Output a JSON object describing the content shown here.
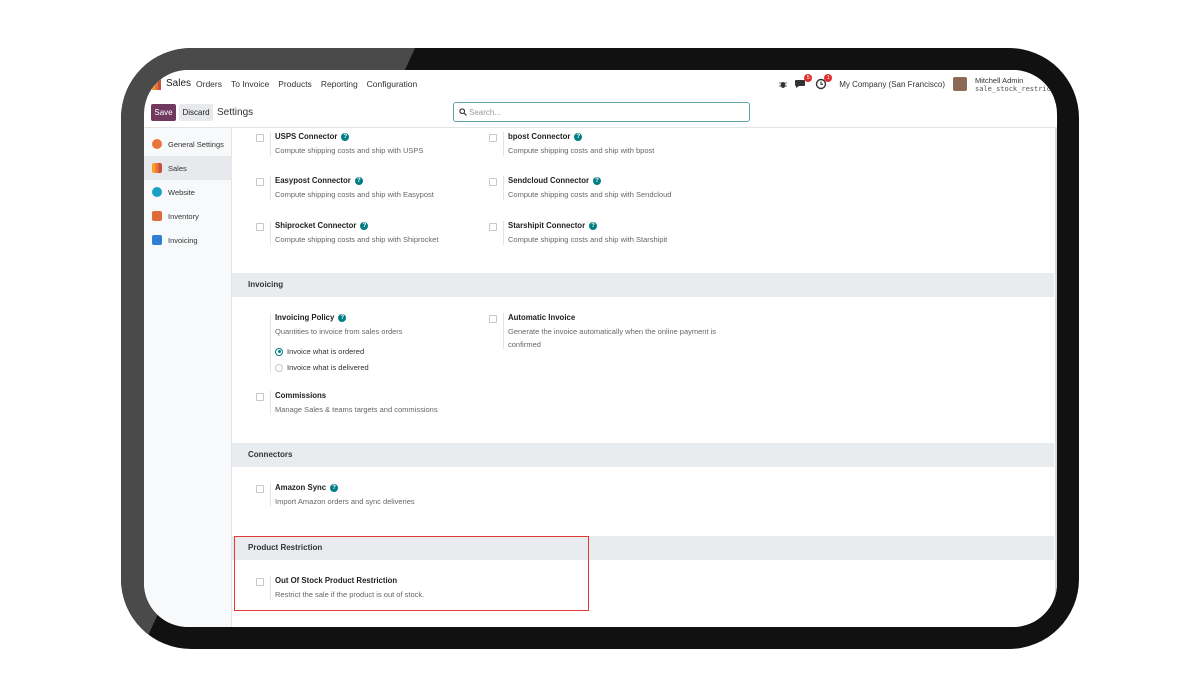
{
  "navbar": {
    "brand": "Sales",
    "menu": [
      "Orders",
      "To Invoice",
      "Products",
      "Reporting",
      "Configuration"
    ],
    "messages_badge": "5",
    "activity_badge": "1",
    "company": "My Company (San Francisco)",
    "user_name": "Mitchell Admin",
    "database": "sale_stock_restriction"
  },
  "control": {
    "save_label": "Save",
    "discard_label": "Discard",
    "title": "Settings",
    "search_placeholder": "Search..."
  },
  "sidebar": {
    "items": [
      {
        "label": "General Settings",
        "color": "#e8743b"
      },
      {
        "label": "Sales",
        "color": "#e8743b",
        "active": true
      },
      {
        "label": "Website",
        "color": "#1b9fc7"
      },
      {
        "label": "Inventory",
        "color": "#e06a3a"
      },
      {
        "label": "Invoicing",
        "color": "#2d7fd3"
      }
    ]
  },
  "shipping": {
    "items": [
      {
        "title": "USPS Connector",
        "desc": "Compute shipping costs and ship with USPS",
        "help": true
      },
      {
        "title": "bpost Connector",
        "desc": "Compute shipping costs and ship with bpost",
        "help": true
      },
      {
        "title": "Easypost Connector",
        "desc": "Compute shipping costs and ship with Easypost",
        "help": true
      },
      {
        "title": "Sendcloud Connector",
        "desc": "Compute shipping costs and ship with Sendcloud",
        "help": true
      },
      {
        "title": "Shiprocket Connector",
        "desc": "Compute shipping costs and ship with Shiprocket",
        "help": true
      },
      {
        "title": "Starshipit Connector",
        "desc": "Compute shipping costs and ship with Starshipit",
        "help": true
      }
    ]
  },
  "invoicing": {
    "header": "Invoicing",
    "policy_title": "Invoicing Policy",
    "policy_desc": "Quantities to invoice from sales orders",
    "option_ordered": "Invoice what is ordered",
    "option_delivered": "Invoice what is delivered",
    "auto_title": "Automatic Invoice",
    "auto_desc_1": "Generate the invoice automatically when the online payment is",
    "auto_desc_2": "confirmed",
    "commissions_title": "Commissions",
    "commissions_desc": "Manage Sales & teams targets and commissions"
  },
  "connectors": {
    "header": "Connectors",
    "amazon_title": "Amazon Sync",
    "amazon_desc": "Import Amazon orders and sync deliveries"
  },
  "restriction": {
    "header": "Product Restriction",
    "title": "Out Of Stock Product Restriction",
    "desc": "Restrict the sale if the product is out of stock."
  },
  "colors": {
    "brand": "#71395f",
    "accent": "#017e84",
    "highlight": "#e53935"
  }
}
